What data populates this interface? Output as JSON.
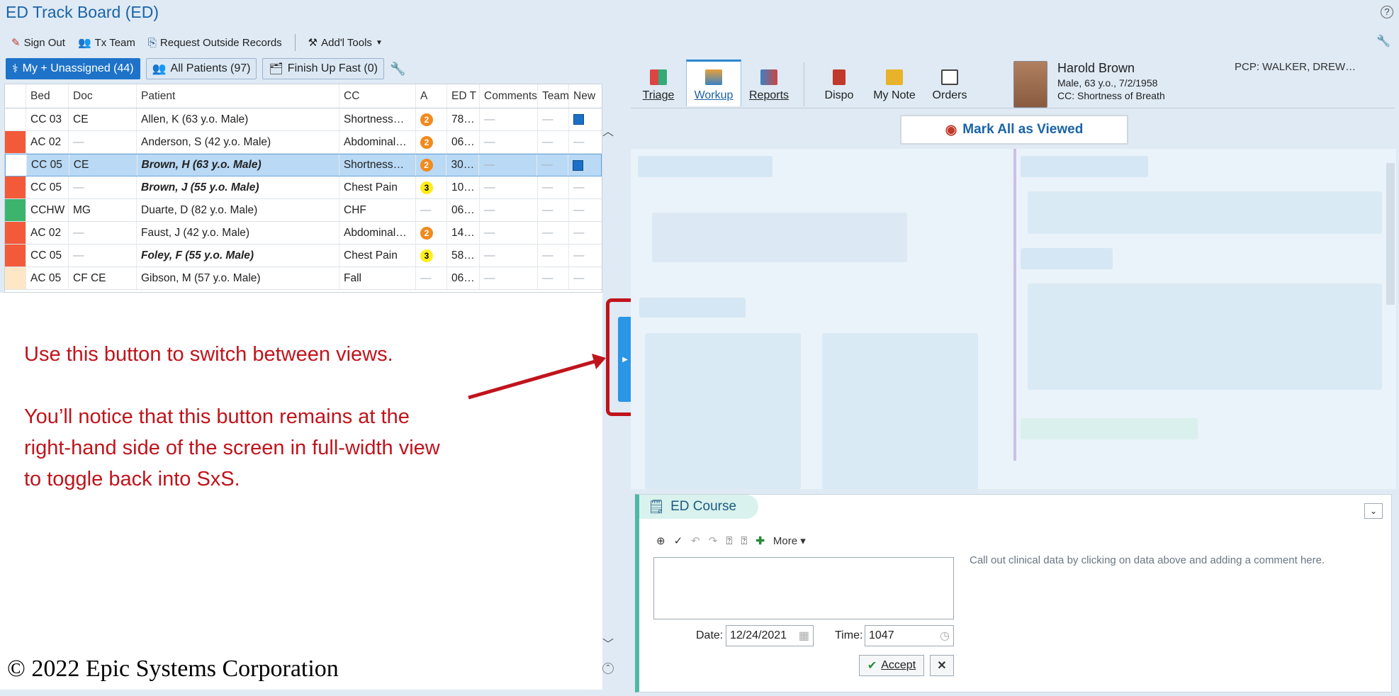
{
  "app": {
    "title": "ED Track Board (ED)",
    "help": "?"
  },
  "toolbar": {
    "sign_out": "Sign Out",
    "tx_team": "Tx Team",
    "request_outside": "Request Outside Records",
    "addl_tools": "Add'l Tools"
  },
  "tabs": [
    {
      "label": "My + Unassigned (44)"
    },
    {
      "label": "All Patients (97)"
    },
    {
      "label": "Finish Up Fast (0)"
    }
  ],
  "grid": {
    "columns": [
      "Bed",
      "Doc",
      "Patient",
      "CC",
      "A",
      "ED T",
      "Comments",
      "Team",
      "New"
    ],
    "rows": [
      {
        "flag": "#ffffff",
        "bed": "CC 03",
        "doc": "CE",
        "patient": "Allen, K (63 y.o. Male)",
        "cc": "Shortness…",
        "acuity": "2",
        "ed": "78…",
        "new": true
      },
      {
        "flag": "#f25a3a",
        "bed": "AC 02",
        "doc": "—",
        "patient": "Anderson, S (42 y.o. Male)",
        "cc": "Abdominal…",
        "acuity": "2",
        "ed": "06…",
        "new": false
      },
      {
        "flag": "#ffffff",
        "bed": "CC 05",
        "doc": "CE",
        "patient": "Brown, H (63 y.o. Male)",
        "cc": "Shortness…",
        "acuity": "2",
        "ed": "30…",
        "new": true
      },
      {
        "flag": "#f25a3a",
        "bed": "CC 05",
        "doc": "—",
        "patient": "Brown, J (55 y.o. Male)",
        "cc": "Chest Pain",
        "acuity": "3",
        "ed": "10…",
        "new": false
      },
      {
        "flag": "#3cb46e",
        "bed": "CCHW",
        "doc": "MG",
        "patient": "Duarte, D (82 y.o. Male)",
        "cc": "CHF",
        "acuity": "—",
        "ed": "06…",
        "new": false
      },
      {
        "flag": "#f25a3a",
        "bed": "AC 02",
        "doc": "—",
        "patient": "Faust, J (42 y.o. Male)",
        "cc": "Abdominal…",
        "acuity": "2",
        "ed": "14…",
        "new": false
      },
      {
        "flag": "#f25a3a",
        "bed": "CC 05",
        "doc": "—",
        "patient": "Foley, F (55 y.o. Male)",
        "cc": "Chest Pain",
        "acuity": "3",
        "ed": "58…",
        "new": false
      },
      {
        "flag": "#fde7c6",
        "bed": "AC 05",
        "doc": "CF CE",
        "patient": "Gibson, M (57 y.o. Male)",
        "cc": "Fall",
        "acuity": "—",
        "ed": "06…",
        "new": false
      }
    ]
  },
  "annotation": {
    "line1": "Use this button to switch between views.",
    "line2": "You’ll notice that this button remains at the",
    "line3": "right-hand side of the screen in full-width view",
    "line4": "to toggle back into SxS."
  },
  "copyright": "© 2022 Epic Systems Corporation",
  "activities": [
    {
      "label": "Triage"
    },
    {
      "label": "Workup"
    },
    {
      "label": "Reports"
    },
    {
      "label": "Dispo"
    },
    {
      "label": "My Note"
    },
    {
      "label": "Orders"
    }
  ],
  "patient": {
    "name": "Harold Brown",
    "demo": "Male, 63 y.o., 7/2/1958",
    "cc": "CC: Shortness of Breath",
    "pcp": "PCP: WALKER, DREW…"
  },
  "mark_all": "Mark All as Viewed",
  "ed_course": {
    "title": "ED Course",
    "more": "More",
    "hint": "Call out clinical data by clicking on data above and adding a comment here.",
    "date_label": "Date:",
    "date_value": "12/24/2021",
    "time_label": "Time:",
    "time_value": "1047",
    "accept": "Accept"
  },
  "colors": {
    "accent": "#1e73c8",
    "annotation_red": "#c0141c"
  }
}
